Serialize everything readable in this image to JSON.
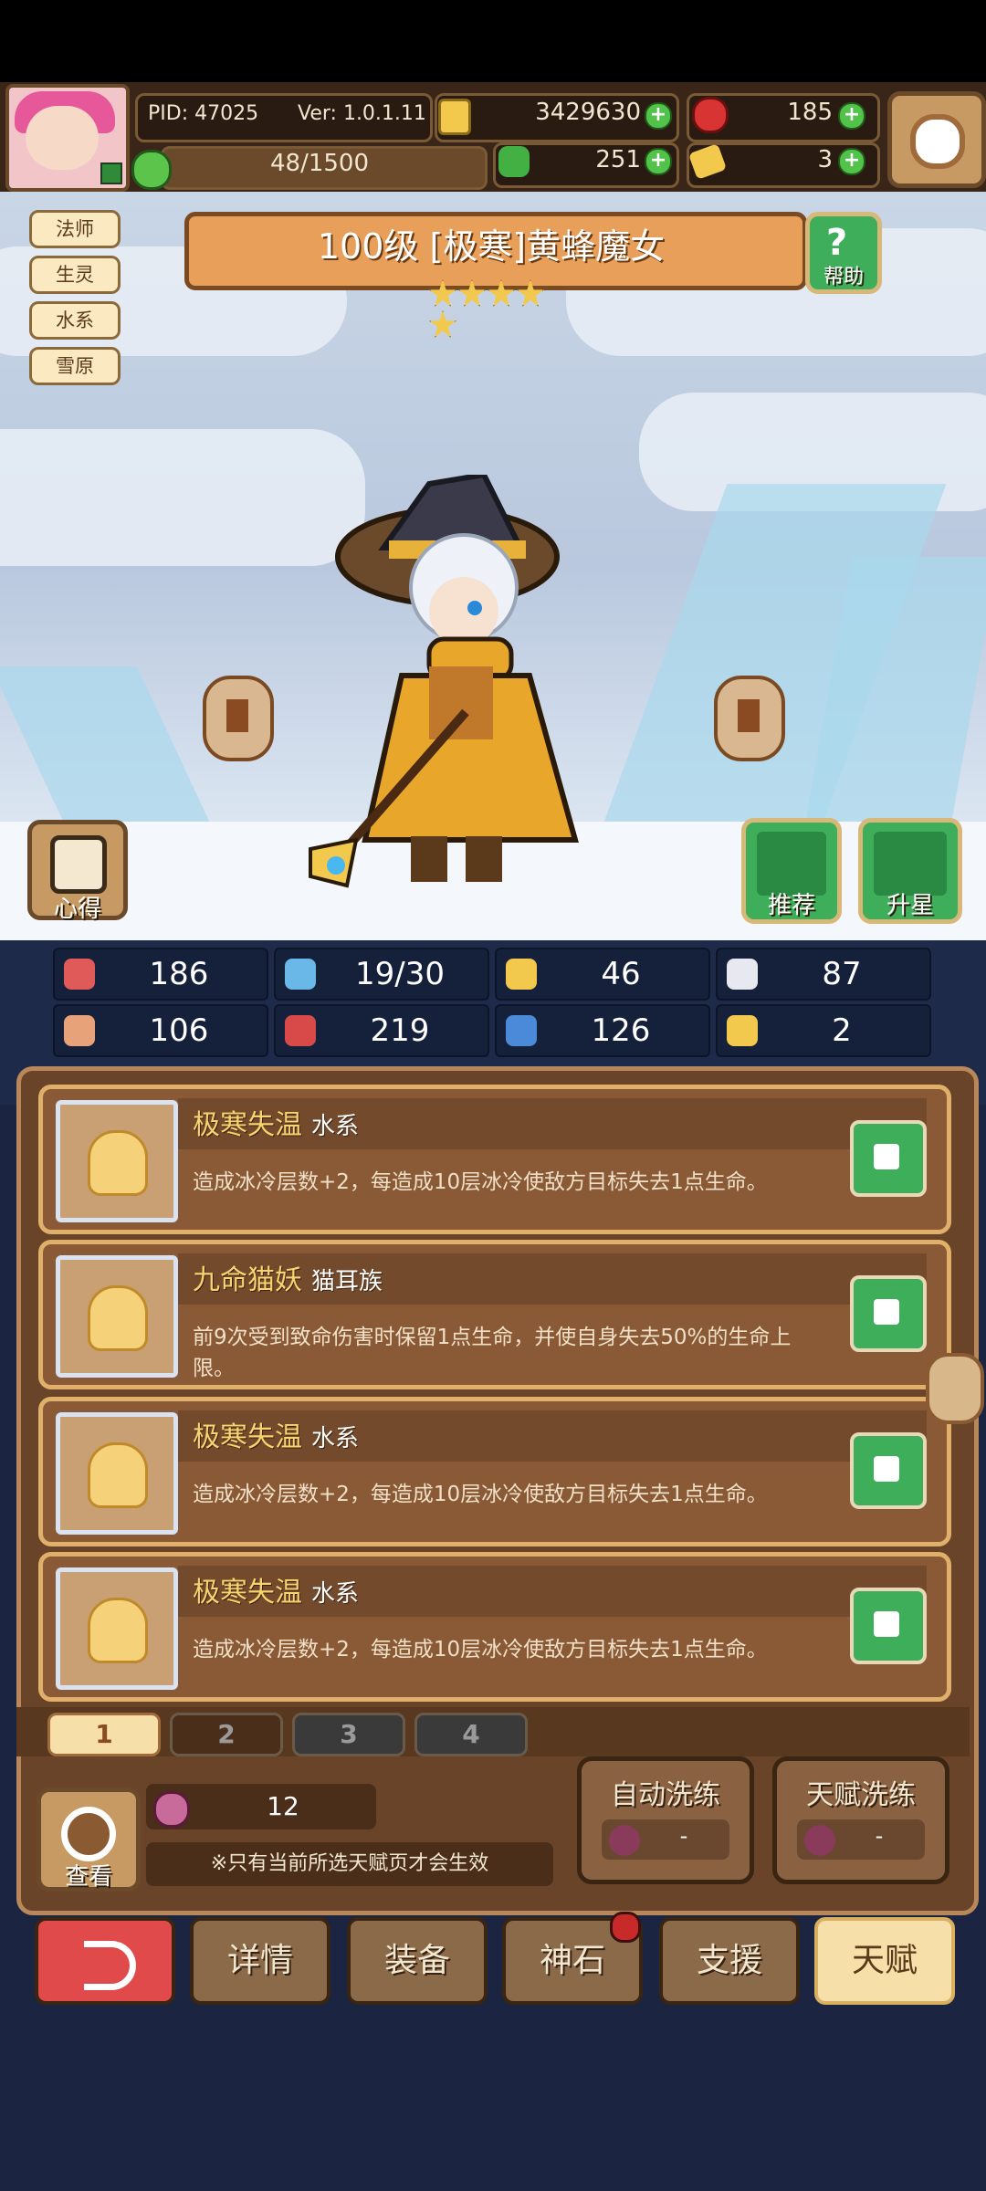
{
  "header": {
    "pid": "PID: 47025",
    "version": "Ver: 1.0.1.11",
    "gold": "3429630",
    "gems": "185",
    "xp": "48/1500",
    "clover": "251",
    "tickets": "3"
  },
  "tags": [
    "法师",
    "生灵",
    "水系",
    "雪原"
  ],
  "character": {
    "title": "100级 [极寒]黄蜂魔女",
    "stars": 5
  },
  "buttons": {
    "help": "帮助",
    "insight": "心得",
    "recommend": "推荐",
    "star_up": "升星",
    "view": "查看",
    "auto_wash": "自动洗练",
    "talent_wash": "天赋洗练",
    "cost_dash": "-"
  },
  "stats": [
    {
      "icon": "heart-icon",
      "value": "186",
      "color": "#e05a5a"
    },
    {
      "icon": "water-drop-icon",
      "value": "19/30",
      "color": "#6ab8e8"
    },
    {
      "icon": "shield-icon",
      "value": "46",
      "color": "#f2c94c"
    },
    {
      "icon": "wing-icon",
      "value": "87",
      "color": "#e8e8f0"
    },
    {
      "icon": "fist-icon",
      "value": "106",
      "color": "#e8a27a"
    },
    {
      "icon": "spellbook-icon",
      "value": "219",
      "color": "#d84a4a"
    },
    {
      "icon": "boot-icon",
      "value": "126",
      "color": "#4a8ad8"
    },
    {
      "icon": "horseshoe-icon",
      "value": "2",
      "color": "#f2c94c"
    }
  ],
  "talents": [
    {
      "name": "极寒失温",
      "type": "水系",
      "desc": "造成冰冷层数+2，每造成10层冰冷使敌方目标失去1点生命。"
    },
    {
      "name": "九命猫妖",
      "type": "猫耳族",
      "desc": "前9次受到致命伤害时保留1点生命，并使自身失去50%的生命上限。"
    },
    {
      "name": "极寒失温",
      "type": "水系",
      "desc": "造成冰冷层数+2，每造成10层冰冷使敌方目标失去1点生命。"
    },
    {
      "name": "极寒失温",
      "type": "水系",
      "desc": "造成冰冷层数+2，每造成10层冰冷使敌方目标失去1点生命。"
    }
  ],
  "pages": [
    "1",
    "2",
    "3",
    "4"
  ],
  "active_page": "1",
  "talent_points": "12",
  "note": "※只有当前所选天赋页才会生效",
  "nav": [
    "详情",
    "装备",
    "神石",
    "支援",
    "天赋"
  ]
}
